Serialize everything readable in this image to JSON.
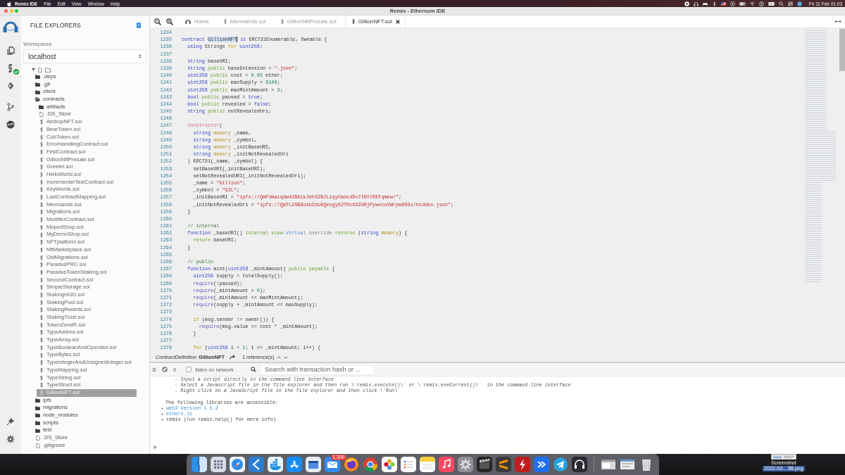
{
  "menu_bar": {
    "app": "Remix IDE",
    "menus": [
      "File",
      "Edit",
      "View",
      "Window",
      "Help"
    ],
    "clock": "Fri 11 Feb 01:03"
  },
  "window": {
    "title": "Remix - Ethereum IDE"
  },
  "file_explorer": {
    "title": "FILE EXPLORERS",
    "workspace_label": "Workspaces",
    "workspace": "localhost",
    "tree": {
      "expanded": true,
      "items": [
        {
          "name": ".deps",
          "kind": "folder",
          "expanded": false,
          "selected": false
        },
        {
          "name": ".git",
          "kind": "folder",
          "expanded": false,
          "selected": false
        },
        {
          "name": "client",
          "kind": "folder",
          "expanded": false,
          "selected": false
        },
        {
          "name": "contracts",
          "kind": "folder",
          "expanded": true,
          "selected": false,
          "children": [
            {
              "name": "artifacts",
              "kind": "folder",
              "expanded": false,
              "selected": false
            },
            {
              "name": ".DS_Store",
              "kind": "file",
              "selected": false
            },
            {
              "name": "AirdropNFT.sol",
              "kind": "sol",
              "selected": false
            },
            {
              "name": "BearToken.sol",
              "kind": "sol",
              "selected": false
            },
            {
              "name": "CubToken.sol",
              "kind": "sol",
              "selected": false
            },
            {
              "name": "ErrorHandlingContract.sol",
              "kind": "sol",
              "selected": false
            },
            {
              "name": "FirstContract.sol",
              "kind": "sol",
              "selected": false
            },
            {
              "name": "GillionNftPresale.sol",
              "kind": "sol",
              "selected": false
            },
            {
              "name": "Greeter.sol",
              "kind": "sol",
              "selected": false
            },
            {
              "name": "HelloWorld.sol",
              "kind": "sol",
              "selected": false
            },
            {
              "name": "IncrementerTestContract.sol",
              "kind": "sol",
              "selected": false
            },
            {
              "name": "KeyWords.sol",
              "kind": "sol",
              "selected": false
            },
            {
              "name": "LastContractMapping.sol",
              "kind": "sol",
              "selected": false
            },
            {
              "name": "Mermainds.sol",
              "kind": "sol",
              "selected": false
            },
            {
              "name": "Migrations.sol",
              "kind": "sol",
              "selected": false
            },
            {
              "name": "ModifierContract.sol",
              "kind": "sol",
              "selected": false
            },
            {
              "name": "MopedShop.sol",
              "kind": "sol",
              "selected": false
            },
            {
              "name": "MyDemoShop.sol",
              "kind": "sol",
              "selected": false
            },
            {
              "name": "NFTplatform.sol",
              "kind": "sol",
              "selected": false
            },
            {
              "name": "NftMarketplace.sol",
              "kind": "sol",
              "selected": false
            },
            {
              "name": "OldMigrations.sol",
              "kind": "sol",
              "selected": false
            },
            {
              "name": "ParadusPRD.sol",
              "kind": "sol",
              "selected": false
            },
            {
              "name": "ParadusTokenStaking.sol",
              "kind": "sol",
              "selected": false
            },
            {
              "name": "SecondContract.sol",
              "kind": "sol",
              "selected": false
            },
            {
              "name": "SimpleStorage.sol",
              "kind": "sol",
              "selected": false
            },
            {
              "name": "StakingHGD.sol",
              "kind": "sol",
              "selected": false
            },
            {
              "name": "StakingPool.sol",
              "kind": "sol",
              "selected": false
            },
            {
              "name": "StakingRwards.sol",
              "kind": "sol",
              "selected": false
            },
            {
              "name": "StakingTrust.sol",
              "kind": "sol",
              "selected": false
            },
            {
              "name": "TokenZendR.sol",
              "kind": "sol",
              "selected": false
            },
            {
              "name": "TypeAddres.sol",
              "kind": "sol",
              "selected": false
            },
            {
              "name": "TypeArray.sol",
              "kind": "sol",
              "selected": false
            },
            {
              "name": "TypeBooleanAndOperator.sol",
              "kind": "sol",
              "selected": false
            },
            {
              "name": "TypeBytes.sol",
              "kind": "sol",
              "selected": false
            },
            {
              "name": "TypeIntegerAndUnsignedInteger.sol",
              "kind": "sol",
              "selected": false
            },
            {
              "name": "TypeMapping.sol",
              "kind": "sol",
              "selected": false
            },
            {
              "name": "TypeString.sol",
              "kind": "sol",
              "selected": false
            },
            {
              "name": "TypeStruct.sol",
              "kind": "sol",
              "selected": false
            },
            {
              "name": "GillionNFT.sol",
              "kind": "sol",
              "selected": true
            }
          ]
        },
        {
          "name": "ipfs",
          "kind": "folder",
          "expanded": false,
          "selected": false
        },
        {
          "name": "migrations",
          "kind": "folder",
          "expanded": false,
          "selected": false
        },
        {
          "name": "node_modules",
          "kind": "folder",
          "expanded": false,
          "selected": false
        },
        {
          "name": "scripts",
          "kind": "folder",
          "expanded": false,
          "selected": false
        },
        {
          "name": "test",
          "kind": "folder",
          "expanded": false,
          "selected": false
        },
        {
          "name": ".DS_Store",
          "kind": "file",
          "selected": false
        },
        {
          "name": ".gitignore",
          "kind": "file",
          "selected": false
        }
      ]
    }
  },
  "tabs": [
    {
      "label": "Home",
      "kind": "home",
      "selected": false
    },
    {
      "label": "Mermainds.sol",
      "kind": "sol",
      "selected": false
    },
    {
      "label": "GillionNftPresale.sol",
      "kind": "sol",
      "selected": false
    },
    {
      "label": "GillionNFT.sol",
      "kind": "sol",
      "selected": true
    }
  ],
  "editor": {
    "lines": [
      {
        "number": "1234"
      },
      {
        "number": "1235",
        "tokens": [
          {
            "text": "contract ",
            "kind": "kw"
          },
          {
            "text": "GillionNFT",
            "kind": "match"
          },
          {
            "text": " is",
            "kind": "kw"
          },
          {
            "text": " ERC721Enumerable, Ownable {",
            "kind": "plain"
          }
        ]
      },
      {
        "number": "1236",
        "tokens": [
          {
            "text": "  using ",
            "kind": "kw"
          },
          {
            "text": "Strings ",
            "kind": "plain"
          },
          {
            "text": "for ",
            "kind": "ctl"
          },
          {
            "text": "uint256",
            "kind": "kw"
          },
          {
            "text": ";",
            "kind": "plain"
          }
        ]
      },
      {
        "number": "1237"
      },
      {
        "number": "1238",
        "tokens": [
          {
            "text": "  string ",
            "kind": "kw"
          },
          {
            "text": "baseURI;",
            "kind": "plain"
          }
        ]
      },
      {
        "number": "1239",
        "tokens": [
          {
            "text": "  string ",
            "kind": "kw"
          },
          {
            "text": "public ",
            "kind": "vis"
          },
          {
            "text": "baseExtension = ",
            "kind": "plain"
          },
          {
            "text": "\".json\"",
            "kind": "str"
          },
          {
            "text": ";",
            "kind": "plain"
          }
        ]
      },
      {
        "number": "1240",
        "tokens": [
          {
            "text": "  uint256 ",
            "kind": "kw"
          },
          {
            "text": "public ",
            "kind": "vis"
          },
          {
            "text": "cost = ",
            "kind": "plain"
          },
          {
            "text": "0.05",
            "kind": "num"
          },
          {
            "text": " ether;",
            "kind": "plain"
          }
        ]
      },
      {
        "number": "1241",
        "tokens": [
          {
            "text": "  uint256 ",
            "kind": "kw"
          },
          {
            "text": "public ",
            "kind": "vis"
          },
          {
            "text": "maxSupply = ",
            "kind": "plain"
          },
          {
            "text": "6100",
            "kind": "num"
          },
          {
            "text": ";",
            "kind": "plain"
          }
        ]
      },
      {
        "number": "1242",
        "tokens": [
          {
            "text": "  uint256 ",
            "kind": "kw"
          },
          {
            "text": "public ",
            "kind": "vis"
          },
          {
            "text": "maxMintAmount = ",
            "kind": "plain"
          },
          {
            "text": "3",
            "kind": "num"
          },
          {
            "text": ";",
            "kind": "plain"
          }
        ]
      },
      {
        "number": "1243",
        "tokens": [
          {
            "text": "  bool ",
            "kind": "kw"
          },
          {
            "text": "public ",
            "kind": "vis"
          },
          {
            "text": "paused = ",
            "kind": "plain"
          },
          {
            "text": "true",
            "kind": "kw"
          },
          {
            "text": ";",
            "kind": "plain"
          }
        ]
      },
      {
        "number": "1244",
        "tokens": [
          {
            "text": "  bool ",
            "kind": "kw"
          },
          {
            "text": "public ",
            "kind": "vis"
          },
          {
            "text": "revealed = ",
            "kind": "plain"
          },
          {
            "text": "false",
            "kind": "kw"
          },
          {
            "text": ";",
            "kind": "plain"
          }
        ]
      },
      {
        "number": "1245",
        "tokens": [
          {
            "text": "  string ",
            "kind": "kw"
          },
          {
            "text": "public ",
            "kind": "vis"
          },
          {
            "text": "notRevealedUri;",
            "kind": "plain"
          }
        ]
      },
      {
        "number": "1246"
      },
      {
        "number": "1247",
        "tokens": [
          {
            "text": "  constructor",
            "kind": "ctor"
          },
          {
            "text": "(",
            "kind": "plain"
          }
        ]
      },
      {
        "number": "1248",
        "tokens": [
          {
            "text": "    string ",
            "kind": "kw"
          },
          {
            "text": "memory ",
            "kind": "mem"
          },
          {
            "text": "_name,",
            "kind": "plain"
          }
        ]
      },
      {
        "number": "1249",
        "tokens": [
          {
            "text": "    string ",
            "kind": "kw"
          },
          {
            "text": "memory ",
            "kind": "mem"
          },
          {
            "text": "_symbol,",
            "kind": "plain"
          }
        ]
      },
      {
        "number": "1250",
        "tokens": [
          {
            "text": "    string ",
            "kind": "kw"
          },
          {
            "text": "memory ",
            "kind": "mem"
          },
          {
            "text": "_initBaseURI,",
            "kind": "plain"
          }
        ]
      },
      {
        "number": "1251",
        "tokens": [
          {
            "text": "    string ",
            "kind": "kw"
          },
          {
            "text": "memory ",
            "kind": "mem"
          },
          {
            "text": "_initNotRevealedUri",
            "kind": "plain"
          }
        ]
      },
      {
        "number": "1252",
        "tokens": [
          {
            "text": "  ) ERC721(_name, _symbol) {",
            "kind": "plain"
          }
        ]
      },
      {
        "number": "1253",
        "tokens": [
          {
            "text": "    setBaseURI(_initBaseURI);",
            "kind": "plain"
          }
        ]
      },
      {
        "number": "1254",
        "tokens": [
          {
            "text": "    setNotRevealedURI(_initNotRevealedUri);",
            "kind": "plain"
          }
        ]
      },
      {
        "number": "1255",
        "tokens": [
          {
            "text": "    _name = ",
            "kind": "plain"
          },
          {
            "text": "\"Gillion\"",
            "kind": "str"
          },
          {
            "text": ";",
            "kind": "plain"
          }
        ]
      },
      {
        "number": "1256",
        "tokens": [
          {
            "text": "    _symbol = ",
            "kind": "plain"
          },
          {
            "text": "\"GIL\"",
            "kind": "str"
          },
          {
            "text": ";",
            "kind": "plain"
          }
        ]
      },
      {
        "number": "1257",
        "tokens": [
          {
            "text": "    _initBaseURI = ",
            "kind": "plain"
          },
          {
            "text": "\"ipfs://QmPdmaiqdw42BAikJehS2BJL1qyUaocdDv7tBYtREFqmew/\"",
            "kind": "str"
          },
          {
            "text": ";",
            "kind": "plain"
          }
        ]
      },
      {
        "number": "1258",
        "tokens": [
          {
            "text": "    _initNotRevealedUri = ",
            "kind": "plain"
          },
          {
            "text": "\"ipfs://QmTL2GB9usbZduKQesgy62TDcXD2GRjPywxcoVWrpw6SSz/hidden.json\"",
            "kind": "str"
          },
          {
            "text": ";",
            "kind": "plain"
          }
        ]
      },
      {
        "number": "1259",
        "tokens": [
          {
            "text": "  }",
            "kind": "plain"
          }
        ]
      },
      {
        "number": "1260"
      },
      {
        "number": "1261",
        "tokens": [
          {
            "text": "  // internal",
            "kind": "com"
          }
        ]
      },
      {
        "number": "1262",
        "tokens": [
          {
            "text": "  function ",
            "kind": "kw"
          },
          {
            "text": "_baseURI() ",
            "kind": "plain"
          },
          {
            "text": "internal view ",
            "kind": "vis"
          },
          {
            "text": "virtual ",
            "kind": "virt"
          },
          {
            "text": "override ",
            "kind": "ovr"
          },
          {
            "text": "returns ",
            "kind": "vis"
          },
          {
            "text": "(",
            "kind": "plain"
          },
          {
            "text": "string ",
            "kind": "kw"
          },
          {
            "text": "memory",
            "kind": "mem"
          },
          {
            "text": ") {",
            "kind": "plain"
          }
        ]
      },
      {
        "number": "1263",
        "tokens": [
          {
            "text": "    return ",
            "kind": "vis"
          },
          {
            "text": "baseURI;",
            "kind": "plain"
          }
        ]
      },
      {
        "number": "1264",
        "tokens": [
          {
            "text": "  }",
            "kind": "plain"
          }
        ]
      },
      {
        "number": "1265"
      },
      {
        "number": "1266",
        "tokens": [
          {
            "text": "  // public",
            "kind": "com"
          }
        ]
      },
      {
        "number": "1267",
        "tokens": [
          {
            "text": "  function ",
            "kind": "kw"
          },
          {
            "text": "mint(",
            "kind": "plain"
          },
          {
            "text": "uint256 ",
            "kind": "kw"
          },
          {
            "text": "_mintAmount) ",
            "kind": "plain"
          },
          {
            "text": "public payable ",
            "kind": "vis"
          },
          {
            "text": "{",
            "kind": "plain"
          }
        ]
      },
      {
        "number": "1268",
        "tokens": [
          {
            "text": "    uint256 ",
            "kind": "kw"
          },
          {
            "text": "supply = totalSupply();",
            "kind": "plain"
          }
        ]
      },
      {
        "number": "1269",
        "tokens": [
          {
            "text": "    require",
            "kind": "fn"
          },
          {
            "text": "(!paused);",
            "kind": "plain"
          }
        ]
      },
      {
        "number": "1270",
        "tokens": [
          {
            "text": "    require",
            "kind": "fn"
          },
          {
            "text": "(_mintAmount > ",
            "kind": "plain"
          },
          {
            "text": "0",
            "kind": "num"
          },
          {
            "text": ");",
            "kind": "plain"
          }
        ]
      },
      {
        "number": "1271",
        "tokens": [
          {
            "text": "    require",
            "kind": "fn"
          },
          {
            "text": "(_mintAmount <= maxMintAmount);",
            "kind": "plain"
          }
        ]
      },
      {
        "number": "1272",
        "tokens": [
          {
            "text": "    require",
            "kind": "fn"
          },
          {
            "text": "(supply + _mintAmount <= maxSupply);",
            "kind": "plain"
          }
        ]
      },
      {
        "number": "1273"
      },
      {
        "number": "1274",
        "tokens": [
          {
            "text": "    if ",
            "kind": "ctl"
          },
          {
            "text": "(msg.sender != owner()) {",
            "kind": "plain"
          }
        ]
      },
      {
        "number": "1275",
        "tokens": [
          {
            "text": "      require",
            "kind": "fn"
          },
          {
            "text": "(msg.value >= cost * _mintAmount);",
            "kind": "plain"
          }
        ]
      },
      {
        "number": "1276",
        "tokens": [
          {
            "text": "    }",
            "kind": "plain"
          }
        ]
      },
      {
        "number": "1277"
      },
      {
        "number": "1278",
        "tokens": [
          {
            "text": "    for ",
            "kind": "ctl"
          },
          {
            "text": "(",
            "kind": "plain"
          },
          {
            "text": "uint256 ",
            "kind": "kw"
          },
          {
            "text": "i = ",
            "kind": "plain"
          },
          {
            "text": "1",
            "kind": "num"
          },
          {
            "text": "; i <= _mintAmount; i++) {",
            "kind": "plain"
          }
        ]
      }
    ]
  },
  "reference_bar": {
    "definition_kind": "ContractDefinition",
    "definition_name": "GillionNFT",
    "references": "1 reference(s)"
  },
  "terminal": {
    "count": "0",
    "listen_on_network": {
      "label": "listen on network",
      "checked": false
    },
    "search": {
      "placeholder": "Search with transaction hash or ..."
    },
    "instructions": [
      "- Input a script directly in the command line interface",
      "- Select a Javascript file in the file explorer and then run \\`remix.execute()\\` or \\`remix.exeCurrent()\\`  in the command line interface",
      "- Right click on a JavaScript file in the file explorer and then click \\`Run\\`"
    ],
    "heading": "The following libraries are accessible:",
    "libraries": [
      {
        "text": "web3 version 1.5.2",
        "kind": "link"
      },
      {
        "text": "ethers.js",
        "kind": "link"
      },
      {
        "text": "remix (run remix.help() for more info)",
        "kind": "plain"
      }
    ],
    "prompt": ">"
  },
  "dock": {
    "mail_badge": "1,300"
  },
  "desktop": {
    "file": {
      "name": "Screenshot",
      "detail": "2022-02-...58.png"
    }
  }
}
